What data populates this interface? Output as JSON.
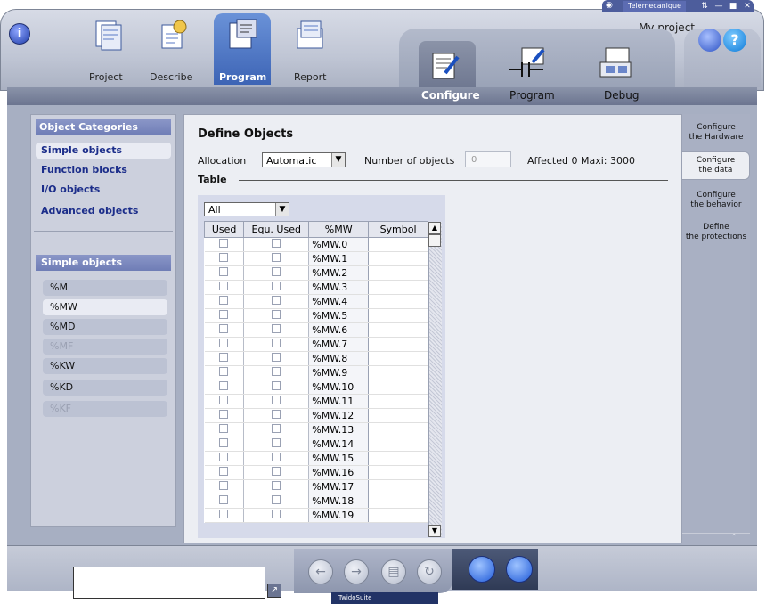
{
  "window": {
    "vendor_label": "Telemecanique",
    "project_name": "My project",
    "globe_icon": "globe-icon",
    "pin_icon": "pin-icon",
    "minimize_icon": "minimize-icon",
    "maximize_icon": "maximize-icon",
    "close_icon": "close-icon"
  },
  "main_tabs": [
    {
      "label": "Project",
      "icon": "project-binder-icon"
    },
    {
      "label": "Describe",
      "icon": "describe-icon"
    },
    {
      "label": "Program",
      "icon": "program-icon",
      "selected": true
    },
    {
      "label": "Report",
      "icon": "report-icon"
    }
  ],
  "sub_tabs": [
    {
      "label": "Configure",
      "icon": "configure-icon",
      "selected": true
    },
    {
      "label": "Program",
      "icon": "ladder-icon"
    },
    {
      "label": "Debug",
      "icon": "debug-icon"
    }
  ],
  "left_panel": {
    "categories_title": "Object Categories",
    "categories": [
      "Simple objects",
      "Function blocks",
      "I/O objects",
      "Advanced objects"
    ],
    "selected_category": "Simple objects",
    "simple_title": "Simple objects",
    "simple_items": [
      {
        "label": "%M",
        "enabled": true
      },
      {
        "label": "%MW",
        "enabled": true,
        "selected": true
      },
      {
        "label": "%MD",
        "enabled": true
      },
      {
        "label": "%MF",
        "enabled": false
      },
      {
        "label": "%KW",
        "enabled": true
      },
      {
        "label": "%KD",
        "enabled": true
      },
      {
        "label": "%KF",
        "enabled": false
      }
    ]
  },
  "content": {
    "title": "Define Objects",
    "allocation_label": "Allocation",
    "allocation_value": "Automatic",
    "num_objects_label": "Number of objects",
    "num_objects_value": "0",
    "affected_text": "Affected 0 Maxi: 3000",
    "table_label": "Table",
    "filter_value": "All",
    "columns": [
      "Used",
      "Equ. Used",
      "%MW",
      "Symbol"
    ],
    "rows": [
      "%MW.0",
      "%MW.1",
      "%MW.2",
      "%MW.3",
      "%MW.4",
      "%MW.5",
      "%MW.6",
      "%MW.7",
      "%MW.8",
      "%MW.9",
      "%MW.10",
      "%MW.11",
      "%MW.12",
      "%MW.13",
      "%MW.14",
      "%MW.15",
      "%MW.16",
      "%MW.17",
      "%MW.18",
      "%MW.19"
    ]
  },
  "right_tabs": [
    {
      "line1": "Configure",
      "line2": "the Hardware"
    },
    {
      "line1": "Configure",
      "line2": "the data",
      "selected": true
    },
    {
      "line1": "Configure",
      "line2": "the behavior"
    },
    {
      "line1": "Define",
      "line2": "the protections"
    }
  ],
  "bottom": {
    "status_text": "",
    "brand": "TwidoSuite",
    "nav_icons": [
      "back-icon",
      "forward-icon",
      "save-icon",
      "refresh-icon"
    ],
    "action_icons": [
      "plc-connect-icon",
      "module-icon"
    ]
  }
}
